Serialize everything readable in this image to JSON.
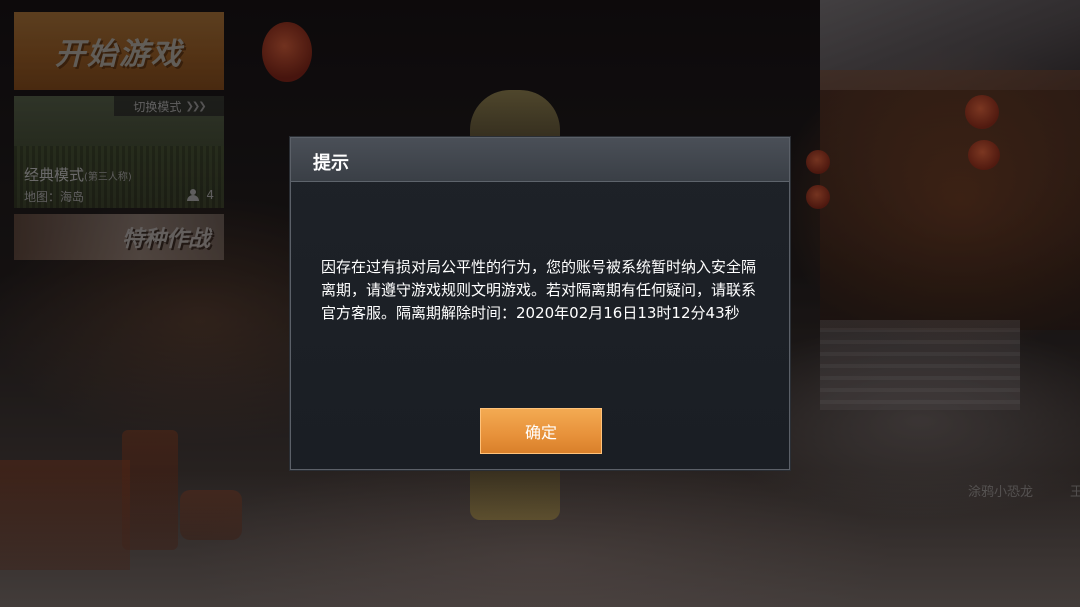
{
  "left_panel": {
    "start_button": "开始游戏",
    "mode_card": {
      "switch_label": "切换模式",
      "mode_name": "经典模式",
      "mode_sub": "(第三人称)",
      "map_label": "地图：海岛",
      "player_count": "4"
    },
    "special_button": "特种作战"
  },
  "right_edge": {
    "player_name": "涂鸦小恐龙",
    "partial_text": "王"
  },
  "dialog": {
    "title": "提示",
    "message": "因存在过有损对局公平性的行为，您的账号被系统暂时纳入安全隔离期，请遵守游戏规则文明游戏。若对隔离期有任何疑问，请联系官方客服。隔离期解除时间：2020年02月16日13时12分43秒",
    "confirm_label": "确定"
  },
  "colors": {
    "accent_orange": "#e7913a",
    "dialog_bg": "#1c2026",
    "dialog_header": "#40454c"
  }
}
